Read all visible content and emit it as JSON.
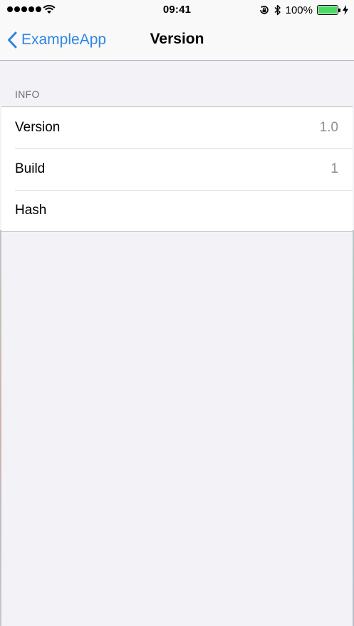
{
  "status_bar": {
    "time": "09:41",
    "battery_percent_label": "100%",
    "battery_level": 1.0,
    "signal_bars": 5,
    "icons": [
      "signal-dots-icon",
      "wifi-icon",
      "rotation-lock-icon",
      "bluetooth-icon",
      "battery-icon",
      "charging-bolt-icon"
    ]
  },
  "nav_bar": {
    "back_label": "ExampleApp",
    "title": "Version"
  },
  "section": {
    "header": "INFO",
    "rows": [
      {
        "label": "Version",
        "value": "1.0"
      },
      {
        "label": "Build",
        "value": "1"
      },
      {
        "label": "Hash",
        "value": ""
      }
    ]
  },
  "colors": {
    "accent": "#2f85e4",
    "battery_fill": "#4cd964",
    "background": "#f2f2f7",
    "secondary_text": "#8e8e93"
  }
}
